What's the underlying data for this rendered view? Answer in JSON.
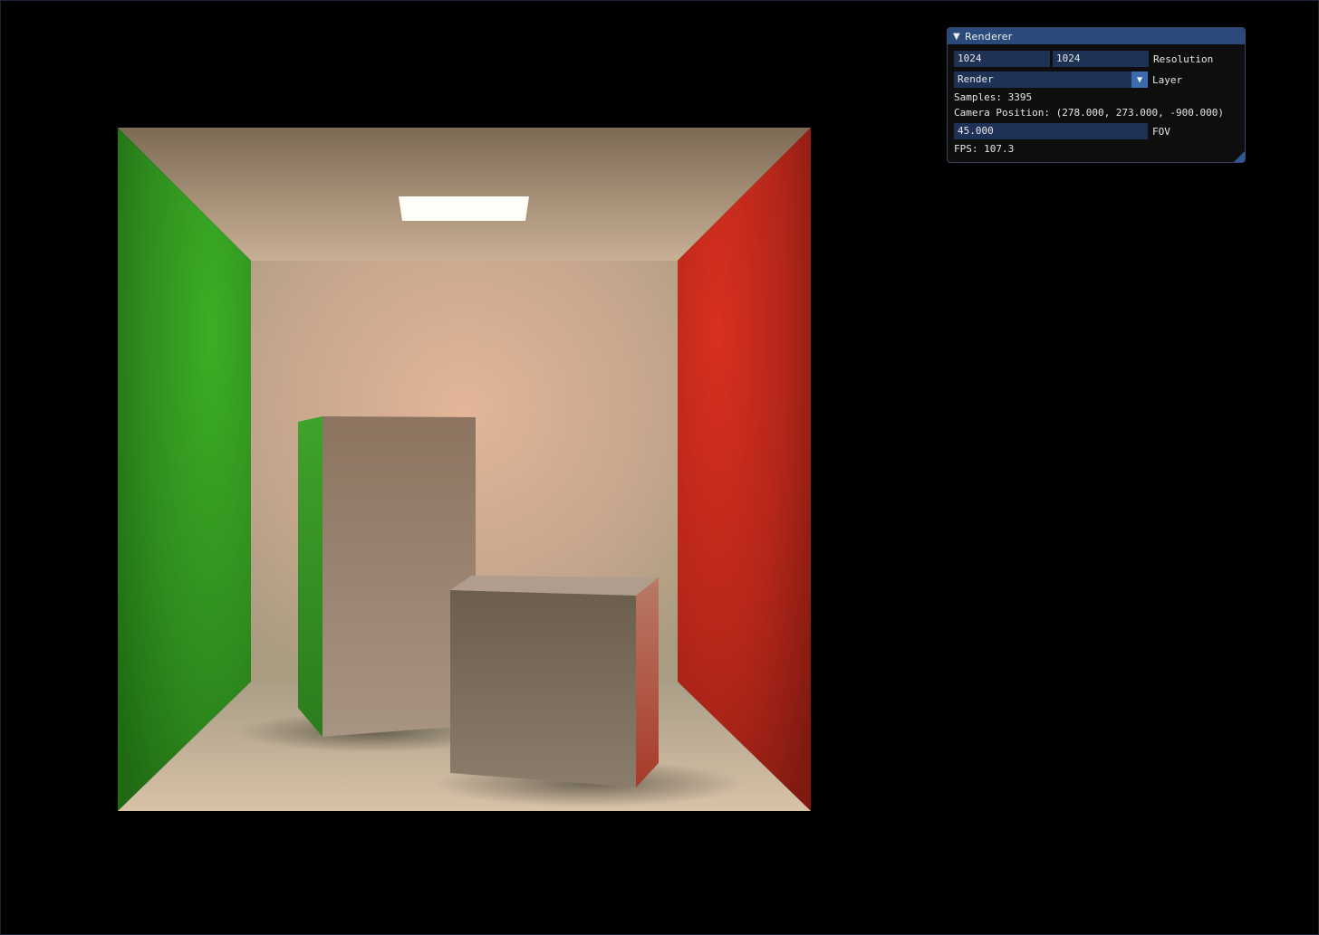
{
  "renderer_window": {
    "title": "Renderer",
    "resolution": {
      "width_value": "1024",
      "height_value": "1024",
      "label": "Resolution"
    },
    "layer": {
      "selected": "Render",
      "label": "Layer"
    },
    "samples_text": "Samples: 3395",
    "camera_position_text": "Camera Position: (278.000, 273.000, -900.000)",
    "fov": {
      "value": "45.000",
      "label": "FOV"
    },
    "fps_text": "FPS: 107.3"
  },
  "icons": {
    "collapse": "collapse-triangle-icon",
    "combo_arrow": "chevron-down-icon",
    "resize": "resize-grip-icon"
  },
  "colors": {
    "title_bar": "#294a7a",
    "frame_bg": "#1e3256",
    "combo_button": "#3d6bb0",
    "left_wall": "#2f8f22",
    "right_wall": "#b52a1f",
    "back_wall": "#c8a88a"
  }
}
